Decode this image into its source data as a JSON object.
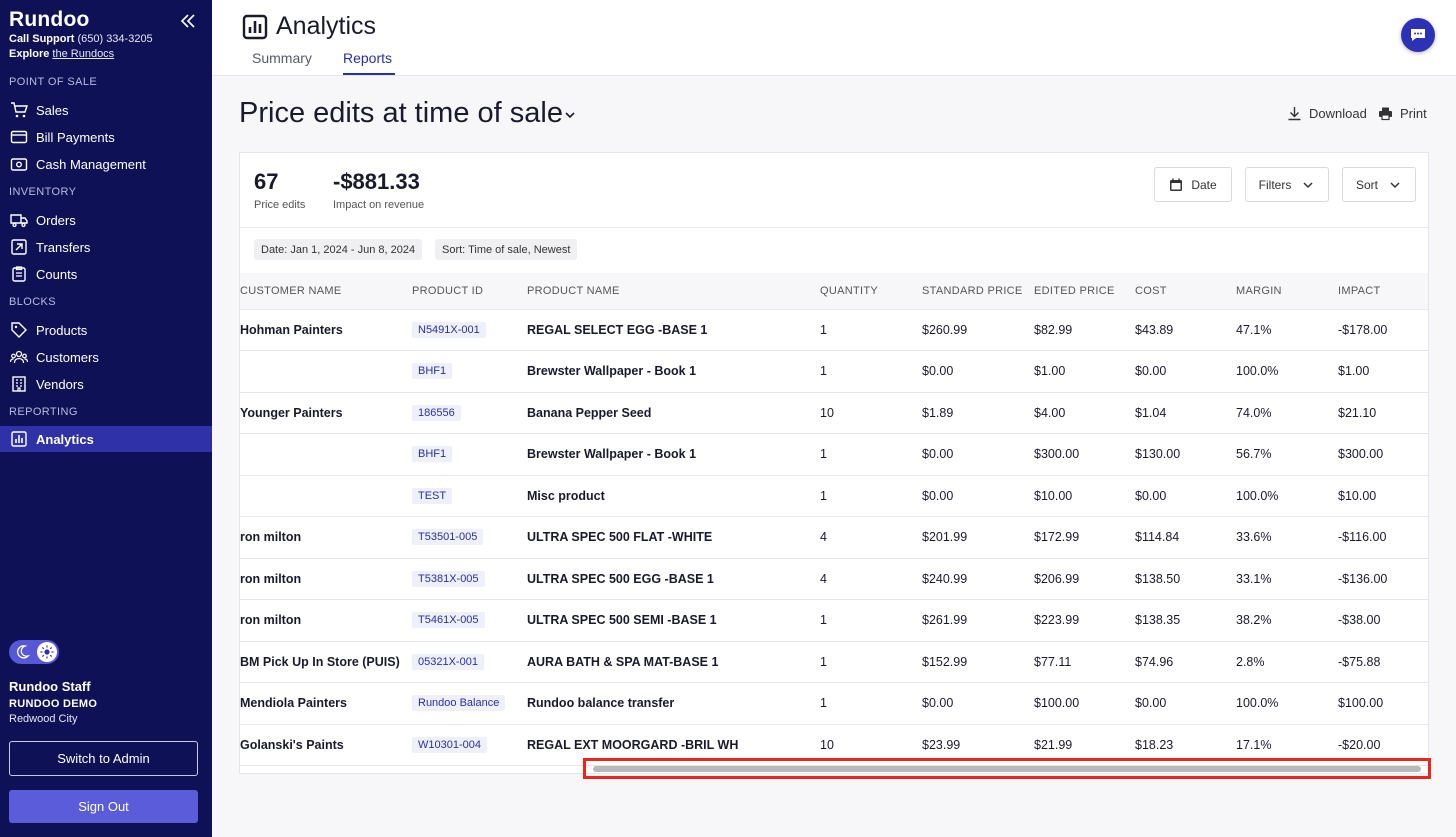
{
  "sidebar": {
    "brand": "Rundoo",
    "support_label": "Call Support",
    "support_phone": "(650) 334-3205",
    "explore_label": "Explore",
    "explore_link": "the Rundocs",
    "sections": {
      "pos": "POINT OF SALE",
      "inventory": "INVENTORY",
      "blocks": "BLOCKS",
      "reporting": "REPORTING"
    },
    "items": {
      "sales": "Sales",
      "bill_payments": "Bill Payments",
      "cash_management": "Cash Management",
      "orders": "Orders",
      "transfers": "Transfers",
      "counts": "Counts",
      "products": "Products",
      "customers": "Customers",
      "vendors": "Vendors",
      "analytics": "Analytics"
    },
    "user_name": "Rundoo Staff",
    "company": "RUNDOO DEMO",
    "city": "Redwood City",
    "switch_admin": "Switch to Admin",
    "sign_out": "Sign Out"
  },
  "header": {
    "title": "Analytics",
    "tabs": [
      "Summary",
      "Reports"
    ],
    "active_tab": "Reports"
  },
  "report": {
    "title": "Price edits at time of sale",
    "download": "Download",
    "print": "Print",
    "kpis": [
      {
        "value": "67",
        "label": "Price edits"
      },
      {
        "value": "-$881.33",
        "label": "Impact on revenue"
      }
    ],
    "controls": {
      "date": "Date",
      "filters": "Filters",
      "sort": "Sort"
    },
    "chips": [
      "Date: Jan 1, 2024 - Jun 8, 2024",
      "Sort: Time of sale, Newest"
    ],
    "columns": [
      "CUSTOMER NAME",
      "PRODUCT ID",
      "PRODUCT NAME",
      "QUANTITY",
      "STANDARD PRICE",
      "EDITED PRICE",
      "COST",
      "MARGIN",
      "IMPACT"
    ],
    "rows": [
      [
        "Hohman Painters",
        "N5491X-001",
        "REGAL SELECT EGG -BASE 1",
        "1",
        "$260.99",
        "$82.99",
        "$43.89",
        "47.1%",
        "-$178.00"
      ],
      [
        "",
        "BHF1",
        "Brewster Wallpaper - Book 1",
        "1",
        "$0.00",
        "$1.00",
        "$0.00",
        "100.0%",
        "$1.00"
      ],
      [
        "Younger Painters",
        "186556",
        "Banana Pepper Seed",
        "10",
        "$1.89",
        "$4.00",
        "$1.04",
        "74.0%",
        "$21.10"
      ],
      [
        "",
        "BHF1",
        "Brewster Wallpaper - Book 1",
        "1",
        "$0.00",
        "$300.00",
        "$130.00",
        "56.7%",
        "$300.00"
      ],
      [
        "",
        "TEST",
        "Misc product",
        "1",
        "$0.00",
        "$10.00",
        "$0.00",
        "100.0%",
        "$10.00"
      ],
      [
        "ron milton",
        "T53501-005",
        "ULTRA SPEC 500 FLAT -WHITE",
        "4",
        "$201.99",
        "$172.99",
        "$114.84",
        "33.6%",
        "-$116.00"
      ],
      [
        "ron milton",
        "T5381X-005",
        "ULTRA SPEC 500 EGG -BASE 1",
        "4",
        "$240.99",
        "$206.99",
        "$138.50",
        "33.1%",
        "-$136.00"
      ],
      [
        "ron milton",
        "T5461X-005",
        "ULTRA SPEC 500 SEMI -BASE 1",
        "1",
        "$261.99",
        "$223.99",
        "$138.35",
        "38.2%",
        "-$38.00"
      ],
      [
        "BM Pick Up In Store (PUIS)",
        "05321X-001",
        "AURA BATH & SPA MAT-BASE 1",
        "1",
        "$152.99",
        "$77.11",
        "$74.96",
        "2.8%",
        "-$75.88"
      ],
      [
        "Mendiola Painters",
        "Rundoo Balance",
        "Rundoo balance transfer",
        "1",
        "$0.00",
        "$100.00",
        "$0.00",
        "100.0%",
        "$100.00"
      ],
      [
        "Golanski's Paints",
        "W10301-004",
        "REGAL EXT MOORGARD -BRIL WH",
        "10",
        "$23.99",
        "$21.99",
        "$18.23",
        "17.1%",
        "-$20.00"
      ]
    ]
  },
  "icons": {
    "collapse": "double-chevron-left-icon",
    "chat": "chat-bubble-icon"
  },
  "colors": {
    "sidebar_bg": "#0f1156",
    "accent": "#2a2fa8",
    "highlight": "#e8281c"
  }
}
